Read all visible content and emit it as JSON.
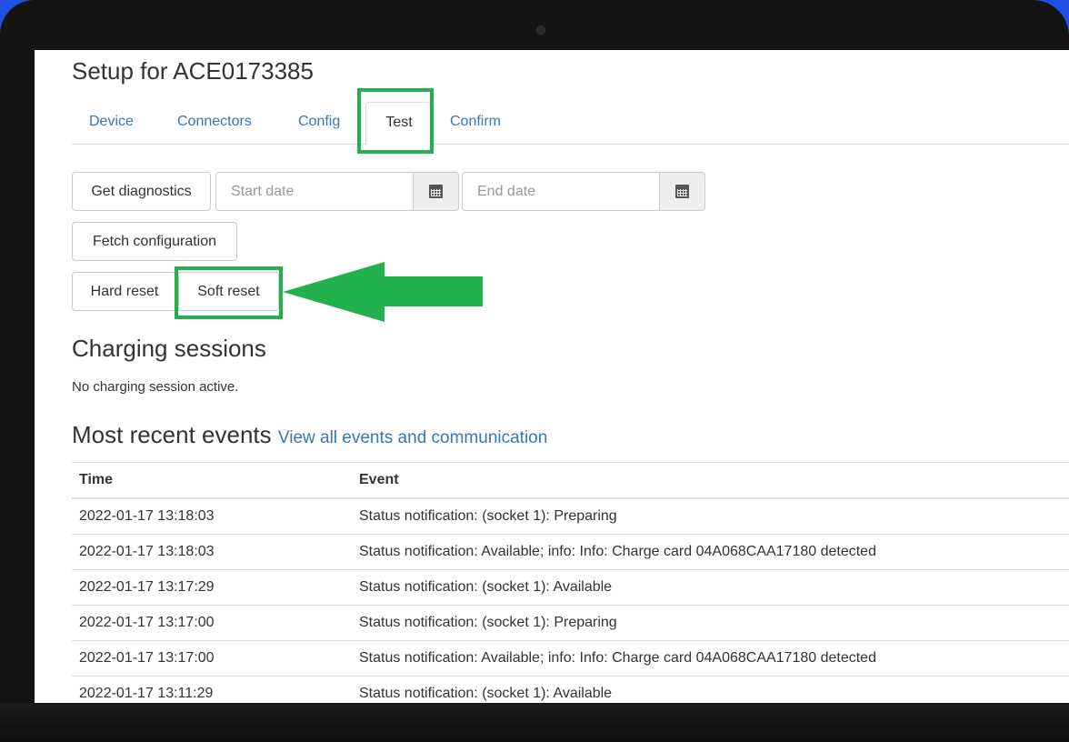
{
  "page": {
    "title": "Setup for ACE0173385"
  },
  "tabs": [
    {
      "label": "Device"
    },
    {
      "label": "Connectors"
    },
    {
      "label": "Config"
    },
    {
      "label": "Test",
      "active": true
    },
    {
      "label": "Confirm"
    }
  ],
  "diagnostics": {
    "button": "Get diagnostics",
    "start_placeholder": "Start date",
    "end_placeholder": "End date",
    "calendar_icon": "calendar-icon"
  },
  "fetch_configuration": "Fetch configuration",
  "reset": {
    "hard": "Hard reset",
    "soft": "Soft reset"
  },
  "sessions": {
    "heading": "Charging sessions",
    "status": "No charging session active."
  },
  "events": {
    "heading": "Most recent events",
    "link": "View all events and communication",
    "columns": [
      "Time",
      "Event"
    ],
    "rows": [
      [
        "2022-01-17 13:18:03",
        "Status notification: (socket 1): Preparing"
      ],
      [
        "2022-01-17 13:18:03",
        "Status notification: Available; info: Info: Charge card 04A068CAA17180 detected"
      ],
      [
        "2022-01-17 13:17:29",
        "Status notification: (socket 1): Available"
      ],
      [
        "2022-01-17 13:17:00",
        "Status notification: (socket 1): Preparing"
      ],
      [
        "2022-01-17 13:17:00",
        "Status notification: Available; info: Info: Charge card 04A068CAA17180 detected"
      ],
      [
        "2022-01-17 13:11:29",
        "Status notification: (socket 1): Available"
      ]
    ]
  },
  "colors": {
    "highlight": "#22b14c",
    "link": "#337ab7",
    "background": "#1e50e6"
  }
}
